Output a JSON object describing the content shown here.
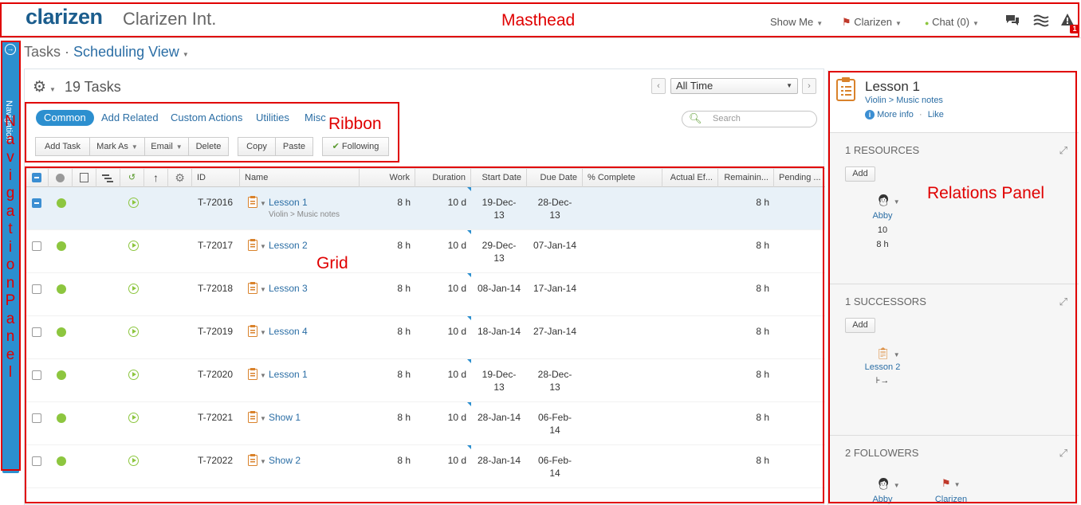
{
  "masthead": {
    "logo": "clarizen",
    "company": "Clarizen Int.",
    "show_me": "Show Me",
    "user": "Clarizen",
    "chat": "Chat (0)",
    "alert_count": "1",
    "icons": [
      "chat-bubbles-icon",
      "activity-stream-icon",
      "alert-icon"
    ]
  },
  "nav": {
    "label": "Navigation"
  },
  "page": {
    "section": "Tasks",
    "separator": "·",
    "view": "Scheduling View"
  },
  "toolbar": {
    "count_label": "19 Tasks",
    "time_filter": "All Time",
    "search_placeholder": "Search"
  },
  "ribbon": {
    "tabs": [
      "Common",
      "Add Related",
      "Custom Actions",
      "Utilities",
      "Misc"
    ],
    "buttons": [
      "Add Task",
      "Mark As",
      "Email",
      "Delete",
      "Copy",
      "Paste",
      "Following"
    ]
  },
  "grid": {
    "columns": [
      "ID",
      "Name",
      "Work",
      "Duration",
      "Start Date",
      "Due Date",
      "% Complete",
      "Actual Ef...",
      "Remainin...",
      "Pending ..."
    ],
    "rows": [
      {
        "id": "T-72016",
        "name": "Lesson 1",
        "path": "Violin > Music notes",
        "work": "8 h",
        "duration": "10 d",
        "start": [
          "19-Dec-",
          "13"
        ],
        "due": [
          "28-Dec-",
          "13"
        ],
        "remaining": "8 h",
        "selected": true
      },
      {
        "id": "T-72017",
        "name": "Lesson 2",
        "path": "",
        "work": "8 h",
        "duration": "10 d",
        "start": [
          "29-Dec-",
          "13"
        ],
        "due": [
          "07-Jan-14",
          ""
        ],
        "remaining": "8 h",
        "selected": false
      },
      {
        "id": "T-72018",
        "name": "Lesson 3",
        "path": "",
        "work": "8 h",
        "duration": "10 d",
        "start": [
          "08-Jan-14",
          ""
        ],
        "due": [
          "17-Jan-14",
          ""
        ],
        "remaining": "8 h",
        "selected": false
      },
      {
        "id": "T-72019",
        "name": "Lesson 4",
        "path": "",
        "work": "8 h",
        "duration": "10 d",
        "start": [
          "18-Jan-14",
          ""
        ],
        "due": [
          "27-Jan-14",
          ""
        ],
        "remaining": "8 h",
        "selected": false
      },
      {
        "id": "T-72020",
        "name": "Lesson 1",
        "path": "",
        "work": "8 h",
        "duration": "10 d",
        "start": [
          "19-Dec-",
          "13"
        ],
        "due": [
          "28-Dec-",
          "13"
        ],
        "remaining": "8 h",
        "selected": false
      },
      {
        "id": "T-72021",
        "name": "Show 1",
        "path": "",
        "work": "8 h",
        "duration": "10 d",
        "start": [
          "28-Jan-14",
          ""
        ],
        "due": [
          "06-Feb-",
          "14"
        ],
        "remaining": "8 h",
        "selected": false
      },
      {
        "id": "T-72022",
        "name": "Show 2",
        "path": "",
        "work": "8 h",
        "duration": "10 d",
        "start": [
          "28-Jan-14",
          ""
        ],
        "due": [
          "06-Feb-",
          "14"
        ],
        "remaining": "8 h",
        "selected": false
      }
    ]
  },
  "relations": {
    "title": "Lesson 1",
    "path": "Violin > Music notes",
    "more_info": "More info",
    "dot": "·",
    "like": "Like",
    "resources": {
      "title": "1 RESOURCES",
      "add": "Add",
      "name": "Abby",
      "units": "10",
      "work": "8 h"
    },
    "successors": {
      "title": "1 SUCCESSORS",
      "add": "Add",
      "name": "Lesson 2",
      "link_type": "⊦→"
    },
    "followers": {
      "title": "2 FOLLOWERS",
      "names": [
        "Abby",
        "Clarizen"
      ]
    }
  },
  "annotations": {
    "masthead": "Masthead",
    "ribbon": "Ribbon",
    "grid": "Grid",
    "relations": "Relations Panel",
    "navigation": "Navigation Panel"
  },
  "colors": {
    "accent": "#2c8fcf",
    "link": "#2b6ea5",
    "status_green": "#8dc63f",
    "annotation_red": "#e00000"
  }
}
